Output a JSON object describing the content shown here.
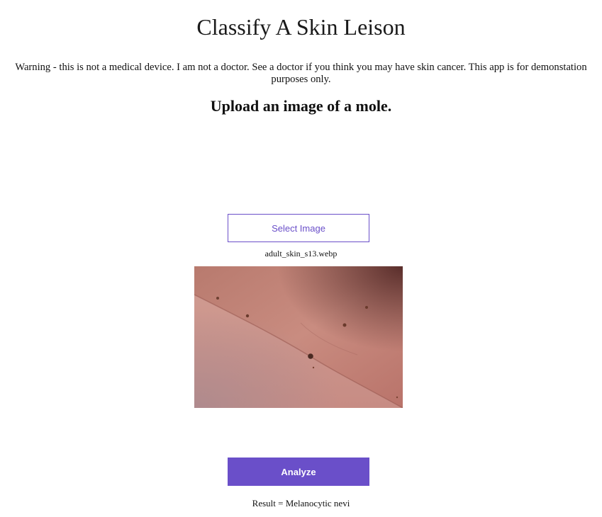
{
  "header": {
    "title": "Classify A Skin Leison",
    "warning": "Warning - this is not a medical device. I am not a doctor. See a doctor if you think you may have skin cancer. This app is for demonstation purposes only.",
    "subtitle": "Upload an image of a mole."
  },
  "upload": {
    "select_label": "Select Image",
    "filename": "adult_skin_s13.webp"
  },
  "actions": {
    "analyze_label": "Analyze"
  },
  "result": {
    "text": "Result = Melanocytic nevi"
  },
  "colors": {
    "accent": "#6a4fc9",
    "background": "#ffffff"
  }
}
